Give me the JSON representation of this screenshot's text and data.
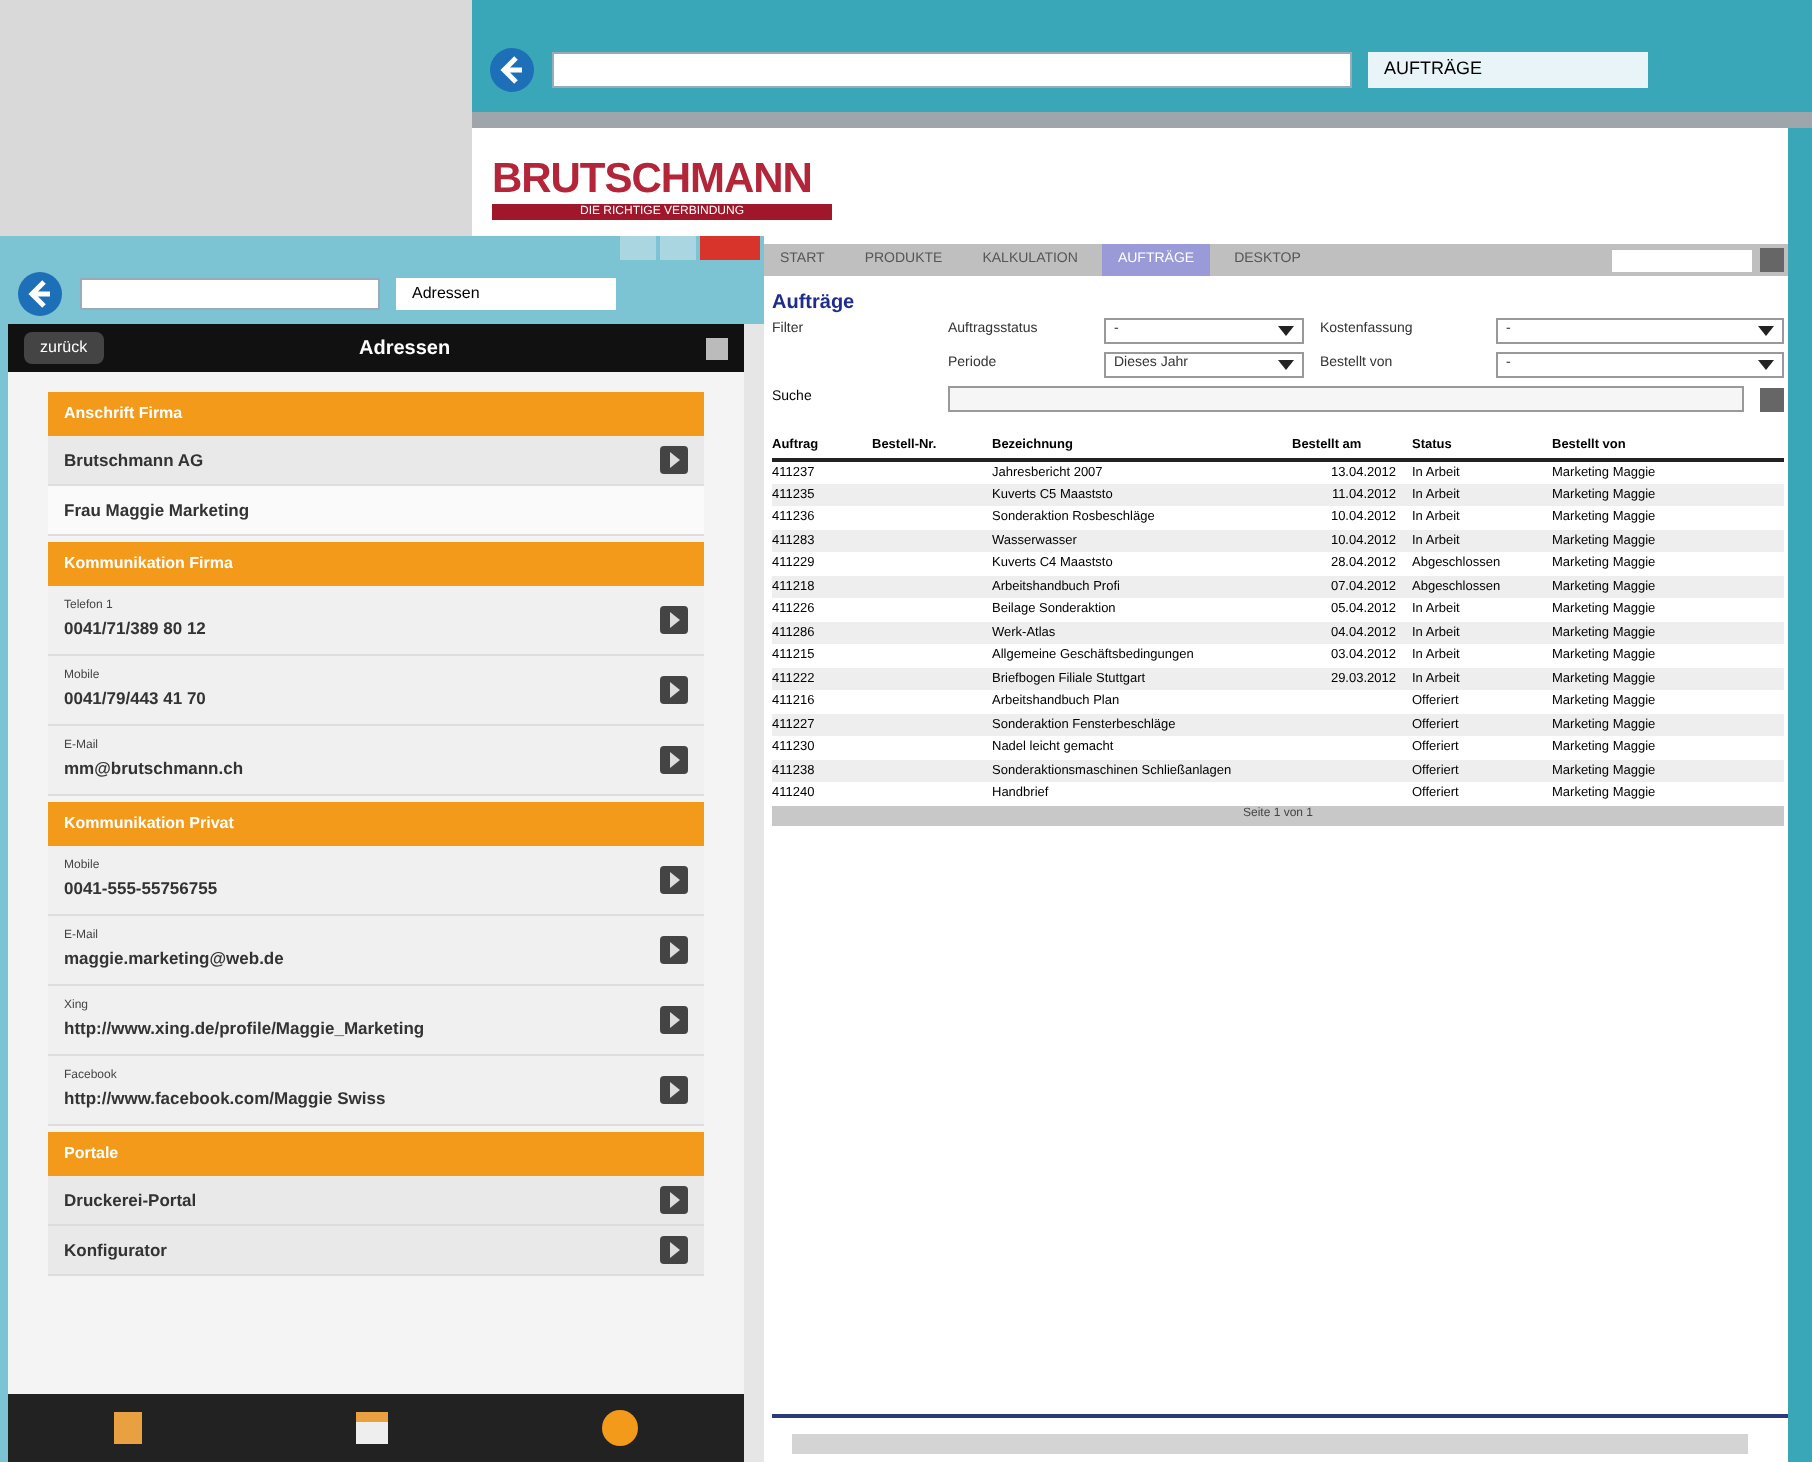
{
  "main_window": {
    "tab": "AUFTRÄGE",
    "logo": "BRUTSCHMANN",
    "tagline": "DIE RICHTIGE VERBINDUNG",
    "nav": [
      {
        "label": "START",
        "selected": false
      },
      {
        "label": "PRODUKTE",
        "selected": false
      },
      {
        "label": "KALKULATION",
        "selected": false
      },
      {
        "label": "AUFTRÄGE",
        "selected": true
      },
      {
        "label": "DESKTOP",
        "selected": false
      }
    ],
    "heading": "Aufträge",
    "filter_label": "Filter",
    "filters": [
      {
        "label": "Auftragsstatus",
        "value": "-"
      },
      {
        "label": "Kostenfassung",
        "value": "-"
      },
      {
        "label": "Periode",
        "value": "Dieses Jahr"
      },
      {
        "label": "Bestellt von",
        "value": "-"
      }
    ],
    "search_label": "Suche",
    "table": {
      "columns": [
        "Auftrag",
        "Bestell-Nr.",
        "Bezeichnung",
        "Bestellt am",
        "Status",
        "Bestellt von"
      ],
      "rows": [
        [
          "411237",
          "",
          "Jahresbericht 2007",
          "13.04.2012",
          "In Arbeit",
          "Marketing Maggie"
        ],
        [
          "411235",
          "",
          "Kuverts C5 Maaststo",
          "11.04.2012",
          "In Arbeit",
          "Marketing Maggie"
        ],
        [
          "411236",
          "",
          "Sonderaktion Rosbeschläge",
          "10.04.2012",
          "In Arbeit",
          "Marketing Maggie"
        ],
        [
          "411283",
          "",
          "Wasserwasser",
          "10.04.2012",
          "In Arbeit",
          "Marketing Maggie"
        ],
        [
          "411229",
          "",
          "Kuverts C4 Maaststo",
          "28.04.2012",
          "Abgeschlossen",
          "Marketing Maggie"
        ],
        [
          "411218",
          "",
          "Arbeitshandbuch Profi",
          "07.04.2012",
          "Abgeschlossen",
          "Marketing Maggie"
        ],
        [
          "411226",
          "",
          "Beilage Sonderaktion",
          "05.04.2012",
          "In Arbeit",
          "Marketing Maggie"
        ],
        [
          "411286",
          "",
          "Werk-Atlas",
          "04.04.2012",
          "In Arbeit",
          "Marketing Maggie"
        ],
        [
          "411215",
          "",
          "Allgemeine Geschäftsbedingungen",
          "03.04.2012",
          "In Arbeit",
          "Marketing Maggie"
        ],
        [
          "411222",
          "",
          "Briefbogen Filiale Stuttgart",
          "29.03.2012",
          "In Arbeit",
          "Marketing Maggie"
        ],
        [
          "411216",
          "",
          "Arbeitshandbuch Plan",
          "",
          "Offeriert",
          "Marketing Maggie"
        ],
        [
          "411227",
          "",
          "Sonderaktion Fensterbeschläge",
          "",
          "Offeriert",
          "Marketing Maggie"
        ],
        [
          "411230",
          "",
          "Nadel leicht gemacht",
          "",
          "Offeriert",
          "Marketing Maggie"
        ],
        [
          "411238",
          "",
          "Sonderaktionsmaschinen Schließanlagen",
          "",
          "Offeriert",
          "Marketing Maggie"
        ],
        [
          "411240",
          "",
          "Handbrief",
          "",
          "Offeriert",
          "Marketing Maggie"
        ]
      ]
    },
    "pager": "Seite 1 von 1"
  },
  "mobile_window": {
    "tab": "Adressen",
    "back": "zurück",
    "title": "Adressen",
    "sections": [
      {
        "header": "Anschrift Firma",
        "items": [
          {
            "kind": "plain",
            "value": "Brutschmann AG",
            "arrow": true
          },
          {
            "kind": "plain",
            "value": "Frau Maggie Marketing",
            "arrow": false
          }
        ]
      },
      {
        "header": "Kommunikation Firma",
        "items": [
          {
            "kind": "labeled",
            "label": "Telefon 1",
            "value": "0041/71/389 80 12",
            "arrow": true
          },
          {
            "kind": "labeled",
            "label": "Mobile",
            "value": "0041/79/443 41 70",
            "arrow": true
          },
          {
            "kind": "labeled",
            "label": "E-Mail",
            "value": "mm@brutschmann.ch",
            "arrow": true
          }
        ]
      },
      {
        "header": "Kommunikation Privat",
        "items": [
          {
            "kind": "labeled",
            "label": "Mobile",
            "value": "0041-555-55756755",
            "arrow": true
          },
          {
            "kind": "labeled",
            "label": "E-Mail",
            "value": "maggie.marketing@web.de",
            "arrow": true
          },
          {
            "kind": "labeled",
            "label": "Xing",
            "value": "http://www.xing.de/profile/Maggie_Marketing",
            "arrow": true
          },
          {
            "kind": "labeled",
            "label": "Facebook",
            "value": "http://www.facebook.com/Maggie Swiss",
            "arrow": true
          }
        ]
      },
      {
        "header": "Portale",
        "items": [
          {
            "kind": "plain",
            "value": "Druckerei-Portal",
            "arrow": true
          },
          {
            "kind": "plain",
            "value": "Konfigurator",
            "arrow": true
          }
        ]
      }
    ]
  }
}
